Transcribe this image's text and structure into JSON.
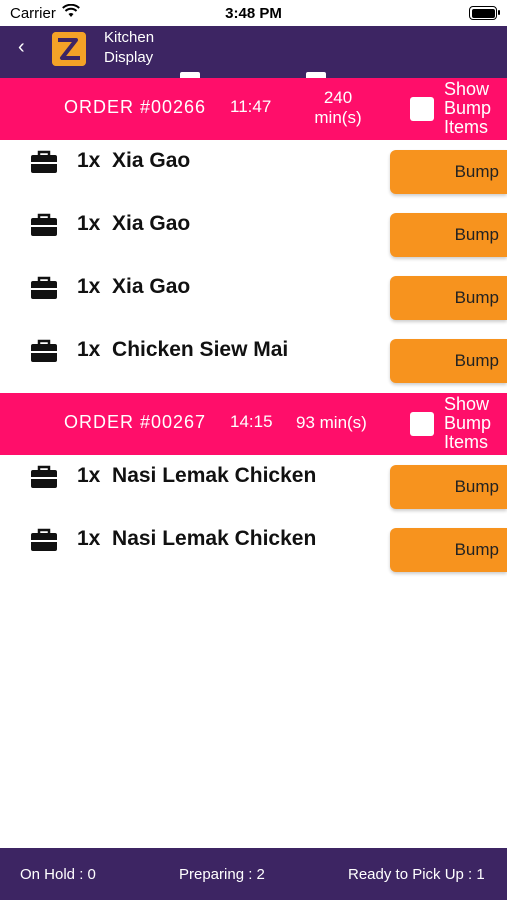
{
  "status_bar": {
    "carrier": "Carrier",
    "time": "3:48 PM"
  },
  "nav": {
    "back_glyph": "‹",
    "title_line1": "Kitchen",
    "title_line2": "Display",
    "logo_icon": "brand-logo-icon"
  },
  "orders": [
    {
      "number": "ORDER #00266",
      "time": "11:47",
      "wait_line1": "240",
      "wait_line2": "min(s)",
      "show_line1": "Show",
      "show_line2": "Bump",
      "show_line3": "Items",
      "items": [
        {
          "qty": "1x",
          "name": "Xia Gao",
          "bump": "Bump"
        },
        {
          "qty": "1x",
          "name": "Xia Gao",
          "bump": "Bump"
        },
        {
          "qty": "1x",
          "name": "Xia Gao",
          "bump": "Bump"
        },
        {
          "qty": "1x",
          "name": "Chicken Siew Mai",
          "bump": "Bump"
        }
      ]
    },
    {
      "number": "ORDER #00267",
      "time": "14:15",
      "wait_line1": "93 min(s)",
      "show_line1": "Show",
      "show_line2": "Bump",
      "show_line3": "Items",
      "items": [
        {
          "qty": "1x",
          "name": "Nasi Lemak Chicken",
          "bump": "Bump"
        },
        {
          "qty": "1x",
          "name": "Nasi Lemak Chicken",
          "bump": "Bump"
        }
      ]
    }
  ],
  "footer": {
    "on_hold": "On Hold : 0",
    "preparing": "Preparing : 2",
    "ready": "Ready to Pick Up : 1"
  },
  "colors": {
    "nav": "#3d2563",
    "order_header": "#ff0e6a",
    "bump_button": "#f7931e"
  }
}
